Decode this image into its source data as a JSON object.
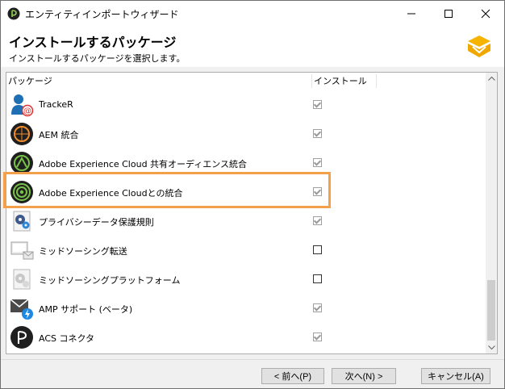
{
  "window": {
    "title": "エンティティインポートウィザード",
    "controls": {
      "minimize": "—",
      "maximize": "☐",
      "close": "✕"
    }
  },
  "header": {
    "title": "インストールするパッケージ",
    "subtitle": "インストールするパッケージを選択します。",
    "logo_color": "#f5b400"
  },
  "table": {
    "columns": [
      "パッケージ",
      "インストール"
    ],
    "rows": [
      {
        "name": "TrackeR",
        "icon": "user-at-icon",
        "checked": true,
        "disabled": true
      },
      {
        "name": "AEM 統合",
        "icon": "aem-icon",
        "checked": true,
        "disabled": true
      },
      {
        "name": "Adobe Experience Cloud 共有オーディエンス統合",
        "icon": "shared-audience-icon",
        "checked": true,
        "disabled": true
      },
      {
        "name": "Adobe Experience Cloudとの統合",
        "icon": "experience-cloud-icon",
        "checked": true,
        "disabled": true
      },
      {
        "name": "プライバシーデータ保護規則",
        "icon": "privacy-gears-icon",
        "checked": true,
        "disabled": true
      },
      {
        "name": "ミッドソーシング転送",
        "icon": "mid-sourcing-transfer-icon",
        "checked": false,
        "disabled": false
      },
      {
        "name": "ミッドソーシングプラットフォーム",
        "icon": "mid-sourcing-platform-icon",
        "checked": false,
        "disabled": false
      },
      {
        "name": "AMP サポート (ベータ)",
        "icon": "amp-mail-icon",
        "checked": true,
        "disabled": true
      },
      {
        "name": "ACS コネクタ",
        "icon": "acs-connector-icon",
        "checked": true,
        "disabled": true
      }
    ],
    "highlight_color": "#f4a04a"
  },
  "footer": {
    "back": "< 前へ(P)",
    "next": "次へ(N) >",
    "cancel": "キャンセル(A)"
  }
}
